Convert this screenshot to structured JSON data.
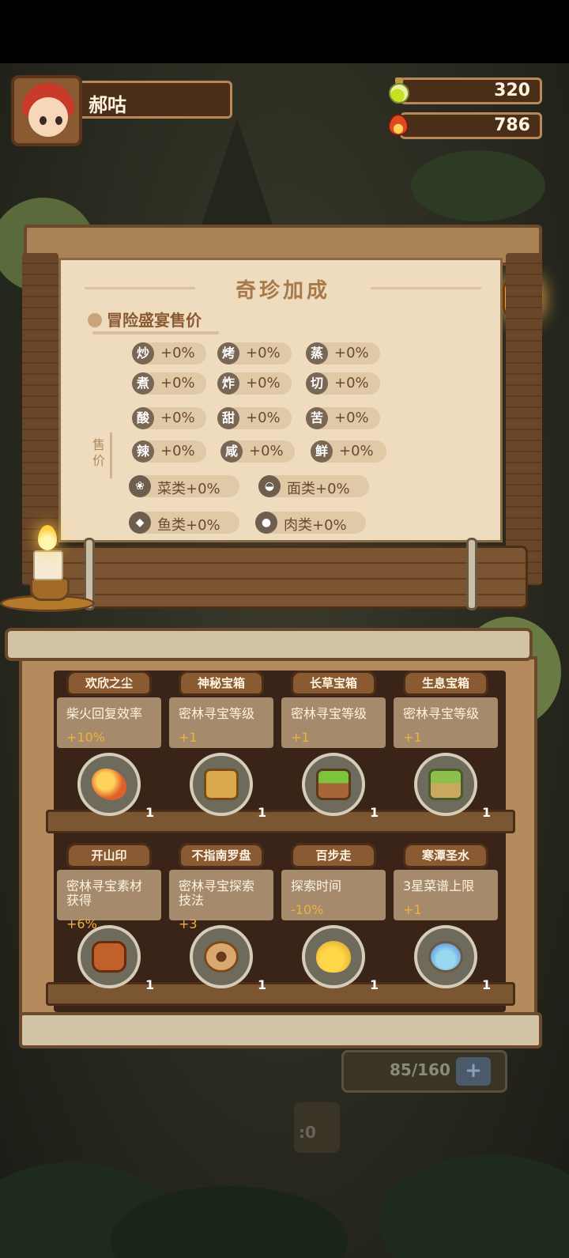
{
  "player": {
    "name": "郝咕"
  },
  "resources": [
    {
      "icon": "potion-icon",
      "value": "320"
    },
    {
      "icon": "flame-icon",
      "value": "786"
    }
  ],
  "bonus_panel": {
    "title": "奇珍加成",
    "section": "冒险盛宴售价",
    "side_label": "售价",
    "flavors": [
      {
        "glyph": "炒",
        "value": "+0%"
      },
      {
        "glyph": "烤",
        "value": "+0%"
      },
      {
        "glyph": "蒸",
        "value": "+0%"
      },
      {
        "glyph": "煮",
        "value": "+0%"
      },
      {
        "glyph": "炸",
        "value": "+0%"
      },
      {
        "glyph": "切",
        "value": "+0%"
      },
      {
        "glyph": "酸",
        "value": "+0%"
      },
      {
        "glyph": "甜",
        "value": "+0%"
      },
      {
        "glyph": "苦",
        "value": "+0%"
      },
      {
        "glyph": "辣",
        "value": "+0%"
      },
      {
        "glyph": "咸",
        "value": "+0%"
      },
      {
        "glyph": "鲜",
        "value": "+0%"
      }
    ],
    "categories": [
      {
        "icon": "vegetable-icon",
        "label": "菜类+0%"
      },
      {
        "icon": "noodle-icon",
        "label": "面类+0%"
      },
      {
        "icon": "fish-icon",
        "label": "鱼类+0%"
      },
      {
        "icon": "meat-icon",
        "label": "肉类+0%"
      }
    ]
  },
  "treasures": [
    {
      "name": "欢欣之尘",
      "desc": "柴火回复效率",
      "bonus": "+10%",
      "count": "1",
      "art": "a-dust"
    },
    {
      "name": "神秘宝箱",
      "desc": "密林寻宝等级",
      "bonus": "+1",
      "count": "1",
      "art": "a-box1"
    },
    {
      "name": "长草宝箱",
      "desc": "密林寻宝等级",
      "bonus": "+1",
      "count": "1",
      "art": "a-box2"
    },
    {
      "name": "生息宝箱",
      "desc": "密林寻宝等级",
      "bonus": "+1",
      "count": "1",
      "art": "a-box3"
    },
    {
      "name": "开山印",
      "desc": "密林寻宝素材获得",
      "bonus": "+6%",
      "count": "1",
      "art": "a-seal"
    },
    {
      "name": "不指南罗盘",
      "desc": "密林寻宝探索技法",
      "bonus": "+3",
      "count": "1",
      "art": "a-compass"
    },
    {
      "name": "百步走",
      "desc": "探索时间",
      "bonus": "-10%",
      "count": "1",
      "art": "a-gourd"
    },
    {
      "name": "寒潭圣水",
      "desc": "3星菜谱上限",
      "bonus": "+1",
      "count": "1",
      "art": "a-bottle"
    }
  ],
  "background": {
    "storage": "85/160",
    "storage_add": "+",
    "stump_count": ":0"
  }
}
